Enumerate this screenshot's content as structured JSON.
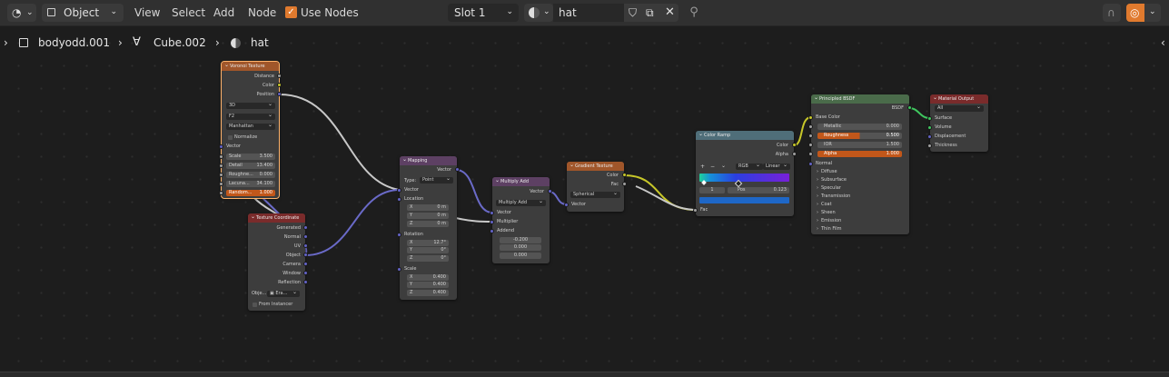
{
  "header": {
    "object_mode": "Object",
    "menus": [
      "View",
      "Select",
      "Add",
      "Node"
    ],
    "use_nodes_label": "Use Nodes",
    "use_nodes_checked": true,
    "slot": "Slot 1",
    "material_name": "hat"
  },
  "breadcrumb": {
    "object": "bodyodd.001",
    "mesh": "Cube.002",
    "material": "hat"
  },
  "nodes": {
    "voronoi": {
      "title": "Voronoi Texture",
      "outputs": [
        "Distance",
        "Color",
        "Position"
      ],
      "dims": "3D",
      "feature": "F2",
      "metric": "Manhattan",
      "normalize_label": "Normalize",
      "vector_label": "Vector",
      "fields": [
        {
          "label": "Scale",
          "value": "3.500"
        },
        {
          "label": "Detail",
          "value": "13.400"
        },
        {
          "label": "Roughne...",
          "value": "0.000"
        },
        {
          "label": "Lacuna...",
          "value": "34.100"
        },
        {
          "label": "Random...",
          "value": "1.000"
        }
      ]
    },
    "texcoord": {
      "title": "Texture Coordinate",
      "outputs": [
        "Generated",
        "Normal",
        "UV",
        "Object",
        "Camera",
        "Window",
        "Reflection"
      ],
      "object_label": "Obje...",
      "object_value": "Era...",
      "from_instancer": "From Instancer"
    },
    "mapping": {
      "title": "Mapping",
      "output": "Vector",
      "type_label": "Type:",
      "type_value": "Point",
      "vector_label": "Vector",
      "location_label": "Location",
      "location": [
        {
          "a": "X",
          "v": "0 m"
        },
        {
          "a": "Y",
          "v": "0 m"
        },
        {
          "a": "Z",
          "v": "0 m"
        }
      ],
      "rotation_label": "Rotation",
      "rotation": [
        {
          "a": "X",
          "v": "12.7°"
        },
        {
          "a": "Y",
          "v": "0°"
        },
        {
          "a": "Z",
          "v": "0°"
        }
      ],
      "scale_label": "Scale",
      "scale": [
        {
          "a": "X",
          "v": "0.400"
        },
        {
          "a": "Y",
          "v": "0.400"
        },
        {
          "a": "Z",
          "v": "0.400"
        }
      ]
    },
    "multiply": {
      "title": "Multiply Add",
      "output": "Vector",
      "op": "Multiply Add",
      "inputs": [
        "Vector",
        "Multiplier",
        "Addend"
      ],
      "addend": [
        "-0.200",
        "0.000",
        "0.000"
      ]
    },
    "gradient": {
      "title": "Gradient Texture",
      "outputs": [
        "Color",
        "Fac"
      ],
      "type": "Spherical",
      "input": "Vector"
    },
    "ramp": {
      "title": "Color Ramp",
      "outputs": [
        "Color",
        "Alpha"
      ],
      "mode": "RGB",
      "interp": "Linear",
      "index": "1",
      "pos_label": "Pos",
      "pos_value": "0.123",
      "input": "Fac"
    },
    "bsdf": {
      "title": "Principled BSDF",
      "output": "BSDF",
      "base_color": "Base Color",
      "fields": [
        {
          "label": "Metallic",
          "value": "0.000",
          "hl": false
        },
        {
          "label": "Roughness",
          "value": "0.500",
          "hl": true
        },
        {
          "label": "IOR",
          "value": "1.500",
          "hl": false
        },
        {
          "label": "Alpha",
          "value": "1.000",
          "hl": true
        }
      ],
      "normal": "Normal",
      "panels": [
        "Diffuse",
        "Subsurface",
        "Specular",
        "Transmission",
        "Coat",
        "Sheen",
        "Emission",
        "Thin Film"
      ]
    },
    "output": {
      "title": "Material Output",
      "target": "All",
      "inputs": [
        "Surface",
        "Volume",
        "Displacement",
        "Thickness"
      ]
    }
  },
  "colors": {
    "texture_header": "#a0562a",
    "vector_header": "#5d4063",
    "converter_header": "#4f6e79",
    "shader_header": "#4a6b4a",
    "output_header": "#7a2b2b",
    "socket_color": "#c7c729",
    "socket_vector": "#6363c7",
    "socket_float": "#a1a1a1",
    "socket_shader": "#3fc75f"
  }
}
